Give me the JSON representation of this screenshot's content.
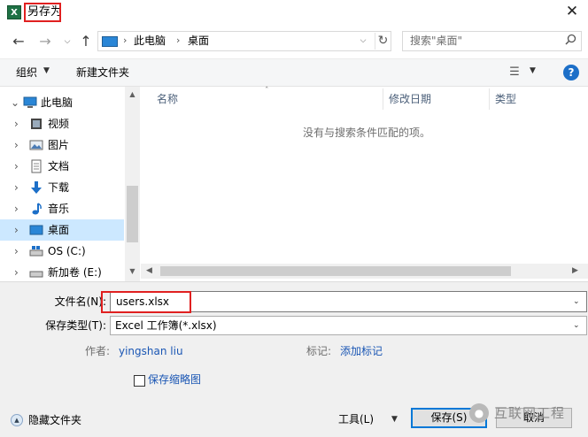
{
  "window": {
    "title": "另存为",
    "app_icon_glyph": "X",
    "close_glyph": "✕"
  },
  "address": {
    "crumbs": [
      "此电脑",
      "桌面"
    ],
    "separator": "›",
    "search_placeholder": "搜索\"桌面\""
  },
  "toolbar": {
    "organize_label": "组织",
    "new_folder_label": "新建文件夹"
  },
  "nav_pane": {
    "items": [
      {
        "label": "此电脑",
        "icon": "computer-icon",
        "expanded": true
      },
      {
        "label": "视频",
        "icon": "video-icon"
      },
      {
        "label": "图片",
        "icon": "pictures-icon"
      },
      {
        "label": "文档",
        "icon": "documents-icon"
      },
      {
        "label": "下载",
        "icon": "download-icon"
      },
      {
        "label": "音乐",
        "icon": "music-icon"
      },
      {
        "label": "桌面",
        "icon": "desktop-icon",
        "selected": true
      },
      {
        "label": "OS (C:)",
        "icon": "drive-icon"
      },
      {
        "label": "新加卷 (E:)",
        "icon": "drive-icon"
      }
    ]
  },
  "file_list": {
    "columns": [
      "名称",
      "修改日期",
      "类型"
    ],
    "empty_message": "没有与搜索条件匹配的项。"
  },
  "form": {
    "filename_label": "文件名(N):",
    "filename_value": "users.xlsx",
    "filetype_label": "保存类型(T):",
    "filetype_value": "Excel 工作簿(*.xlsx)",
    "author_label": "作者:",
    "author_value": "yingshan liu",
    "tags_label": "标记:",
    "tags_value": "添加标记",
    "thumbnail_label": "保存缩略图"
  },
  "footer": {
    "hide_folders_label": "隐藏文件夹",
    "tools_label": "工具(L)",
    "save_label": "保存(S)",
    "cancel_label": "取消"
  },
  "watermark": {
    "text": "互联网工程"
  },
  "colors": {
    "highlight_red": "#e02020",
    "link_blue": "#1a56b4",
    "selection": "#cce8ff",
    "accent": "#0078d7"
  }
}
